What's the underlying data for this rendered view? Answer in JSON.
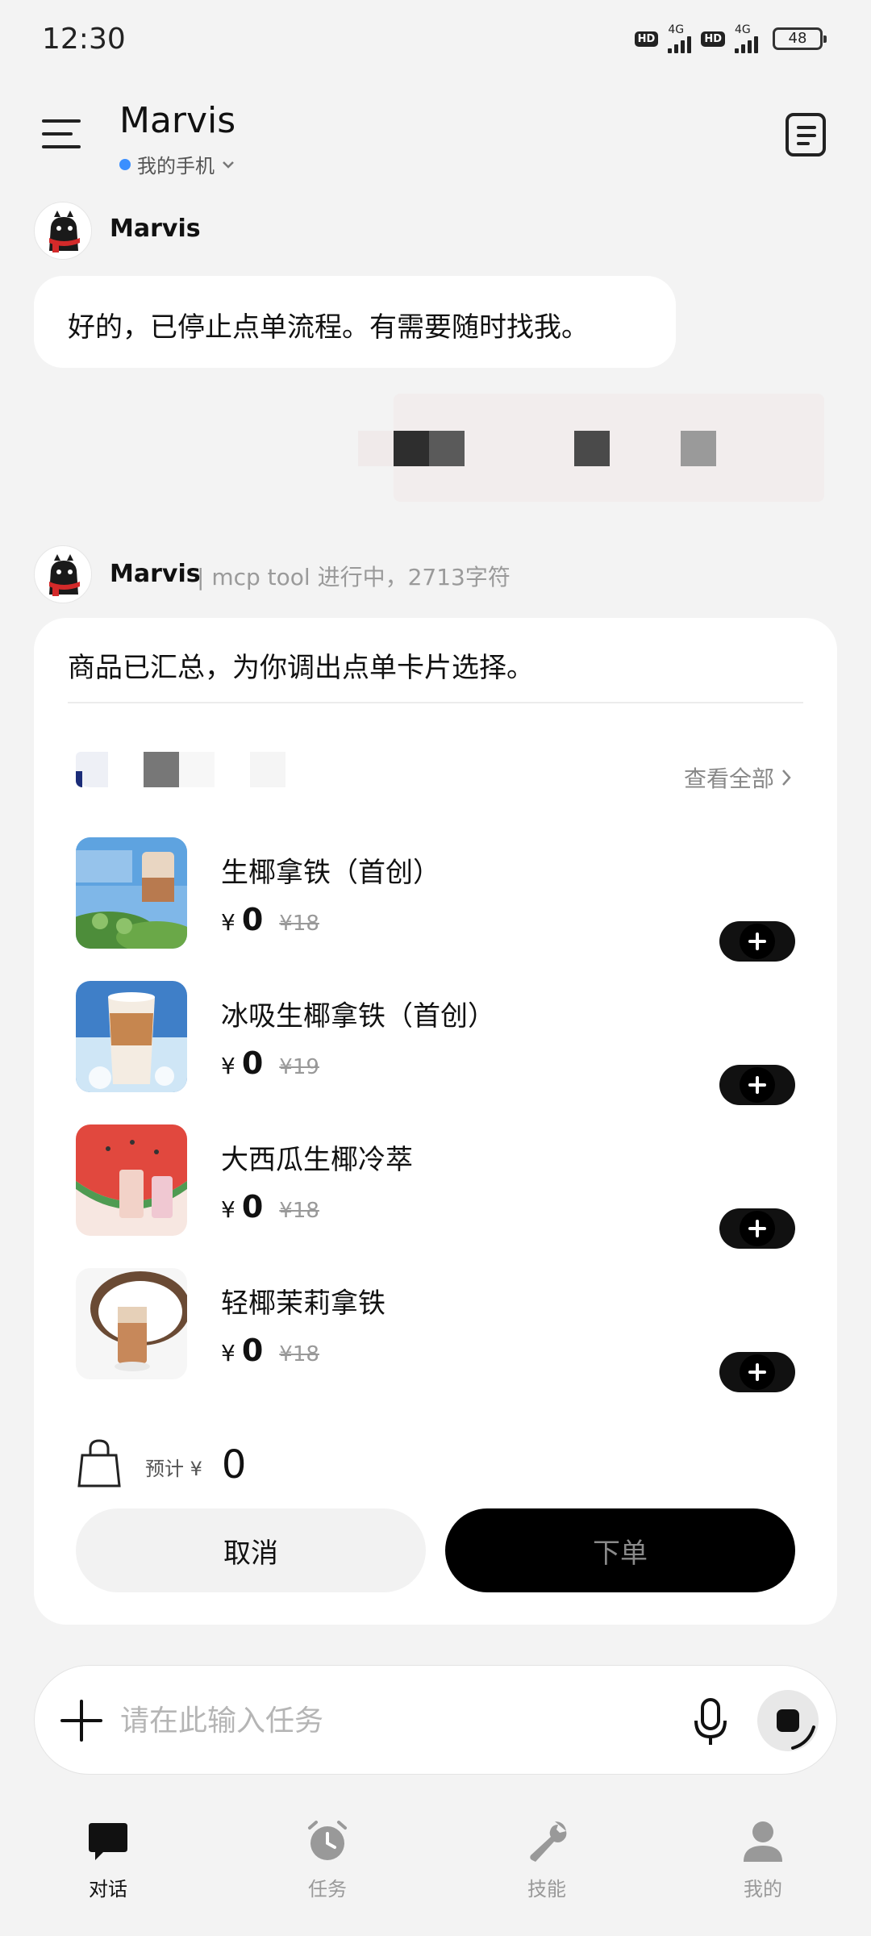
{
  "status_bar": {
    "time": "12:30",
    "net1": "4G",
    "net2": "4G",
    "hd1": "HD",
    "hd2": "HD",
    "battery": "48"
  },
  "header": {
    "title": "Marvis",
    "device": "我的手机",
    "icons": [
      "menu-icon",
      "notes-icon",
      "chevron-down-icon"
    ]
  },
  "chat": {
    "msg1": {
      "sender": "Marvis",
      "text": "好的，已停止点单流程。有需要随时找我。"
    },
    "msg2": {
      "sender": "Marvis",
      "status": "| mcp tool 进行中，2713字符"
    }
  },
  "order_card": {
    "message": "商品已汇总，为你调出点单卡片选择。",
    "view_all": "查看全部",
    "items": [
      {
        "name": "生椰拿铁（首创）",
        "currency": "¥",
        "price": "0",
        "original": "¥18"
      },
      {
        "name": "冰吸生椰拿铁（首创）",
        "currency": "¥",
        "price": "0",
        "original": "¥19"
      },
      {
        "name": "大西瓜生椰冷萃",
        "currency": "¥",
        "price": "0",
        "original": "¥18"
      },
      {
        "name": "轻椰茉莉拿铁",
        "currency": "¥",
        "price": "0",
        "original": "¥18"
      }
    ],
    "total_label": "预计 ¥",
    "total_value": "0",
    "cancel": "取消",
    "submit": "下单"
  },
  "input_bar": {
    "placeholder": "请在此输入任务"
  },
  "bottom_nav": [
    {
      "label": "对话",
      "icon": "chat-icon",
      "active": true
    },
    {
      "label": "任务",
      "icon": "clock-icon",
      "active": false
    },
    {
      "label": "技能",
      "icon": "wrench-icon",
      "active": false
    },
    {
      "label": "我的",
      "icon": "user-icon",
      "active": false
    }
  ],
  "colors": {
    "background": "#f3f3f3",
    "accent": "#000000",
    "device_dot": "#3a8fff"
  }
}
